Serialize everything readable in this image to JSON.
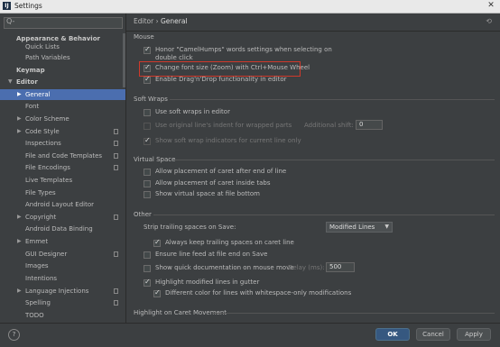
{
  "window": {
    "app_icon": "IJ",
    "title": "Settings",
    "close_glyph": "✕"
  },
  "search": {
    "placeholder": "",
    "icon": "Q-"
  },
  "sidebar": {
    "items": [
      {
        "label": "Appearance & Behavior",
        "bold": true
      },
      {
        "label": "Quick Lists"
      },
      {
        "label": "Path Variables"
      },
      {
        "label": "Keymap",
        "bold": true
      },
      {
        "label": "Editor",
        "bold": true,
        "expanded": true
      },
      {
        "label": "General",
        "selected": true
      },
      {
        "label": "Font"
      },
      {
        "label": "Color Scheme"
      },
      {
        "label": "Code Style"
      },
      {
        "label": "Inspections"
      },
      {
        "label": "File and Code Templates"
      },
      {
        "label": "File Encodings"
      },
      {
        "label": "Live Templates"
      },
      {
        "label": "File Types"
      },
      {
        "label": "Android Layout Editor"
      },
      {
        "label": "Copyright"
      },
      {
        "label": "Android Data Binding"
      },
      {
        "label": "Emmet"
      },
      {
        "label": "GUI Designer"
      },
      {
        "label": "Images"
      },
      {
        "label": "Intentions"
      },
      {
        "label": "Language Injections"
      },
      {
        "label": "Spelling"
      },
      {
        "label": "TODO"
      }
    ]
  },
  "breadcrumb": {
    "parent": "Editor",
    "sep": "›",
    "current": "General",
    "reset_glyph": "⟲"
  },
  "sections": {
    "mouse": "Mouse",
    "soft_wraps": "Soft Wraps",
    "virtual_space": "Virtual Space",
    "other": "Other",
    "highlight_caret": "Highlight on Caret Movement"
  },
  "mouse": {
    "camel_line1": "Honor \"CamelHumps\" words settings when selecting on",
    "camel_line2": "double click",
    "zoom": "Change font size (Zoom) with Ctrl+Mouse Wheel",
    "dnd": "Enable Drag'n'Drop functionality in editor"
  },
  "soft_wraps": {
    "use": "Use soft wraps in editor",
    "indent": "Use original line's indent for wrapped parts",
    "additional_label": "Additional shift:",
    "additional_value": "0",
    "show": "Show soft wrap indicators for current line only"
  },
  "virtual_space": {
    "after_eol": "Allow placement of caret after end of line",
    "inside_tabs": "Allow placement of caret inside tabs",
    "show_bottom": "Show virtual space at file bottom"
  },
  "other": {
    "strip_label": "Strip trailing spaces on Save:",
    "strip_value": "Modified Lines",
    "keep_trailing": "Always keep trailing spaces on caret line",
    "line_feed": "Ensure line feed at file end on Save",
    "quick_doc": "Show quick documentation on mouse move",
    "delay_label": "Delay (ms):",
    "delay_value": "500",
    "highlight_gutter": "Highlight modified lines in gutter",
    "diff_color": "Different color for lines with whitespace-only modifications"
  },
  "footer": {
    "help": "?",
    "ok": "OK",
    "cancel": "Cancel",
    "apply": "Apply"
  },
  "colors": {
    "accent": "#4b6eaf",
    "ok_button": "#365880",
    "highlight_box": "#d0392b"
  }
}
